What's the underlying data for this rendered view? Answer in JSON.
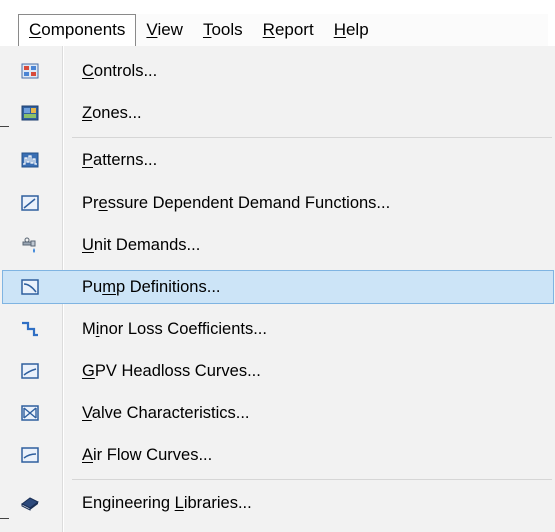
{
  "menubar": [
    {
      "pre": "",
      "u": "C",
      "post": "omponents"
    },
    {
      "pre": "",
      "u": "V",
      "post": "iew"
    },
    {
      "pre": "",
      "u": "T",
      "post": "ools"
    },
    {
      "pre": "",
      "u": "R",
      "post": "eport"
    },
    {
      "pre": "",
      "u": "H",
      "post": "elp"
    }
  ],
  "items": [
    {
      "pre": "",
      "u": "C",
      "post": "ontrols...",
      "icon": "controls-icon"
    },
    {
      "pre": "",
      "u": "Z",
      "post": "ones...",
      "icon": "zones-icon"
    },
    {
      "pre": "",
      "u": "P",
      "post": "atterns...",
      "icon": "patterns-icon"
    },
    {
      "pre": "Pr",
      "u": "e",
      "post": "ssure Dependent Demand Functions...",
      "icon": "pressure-curve-icon"
    },
    {
      "pre": "",
      "u": "U",
      "post": "nit Demands...",
      "icon": "unit-demands-icon"
    },
    {
      "pre": "Pu",
      "u": "m",
      "post": "p Definitions...",
      "icon": "pump-curve-icon"
    },
    {
      "pre": "M",
      "u": "i",
      "post": "nor Loss Coefficients...",
      "icon": "minor-loss-icon"
    },
    {
      "pre": "",
      "u": "G",
      "post": "PV Headloss Curves...",
      "icon": "gpv-curve-icon"
    },
    {
      "pre": "",
      "u": "V",
      "post": "alve Characteristics...",
      "icon": "valve-icon"
    },
    {
      "pre": "",
      "u": "A",
      "post": "ir Flow Curves...",
      "icon": "air-flow-curve-icon"
    },
    {
      "pre": "Engineering ",
      "u": "L",
      "post": "ibraries...",
      "icon": "book-icon"
    }
  ],
  "colors": {
    "highlight_bg": "#cce4f7",
    "highlight_border": "#7fb4e2",
    "menu_bg": "#f2f2f2"
  }
}
